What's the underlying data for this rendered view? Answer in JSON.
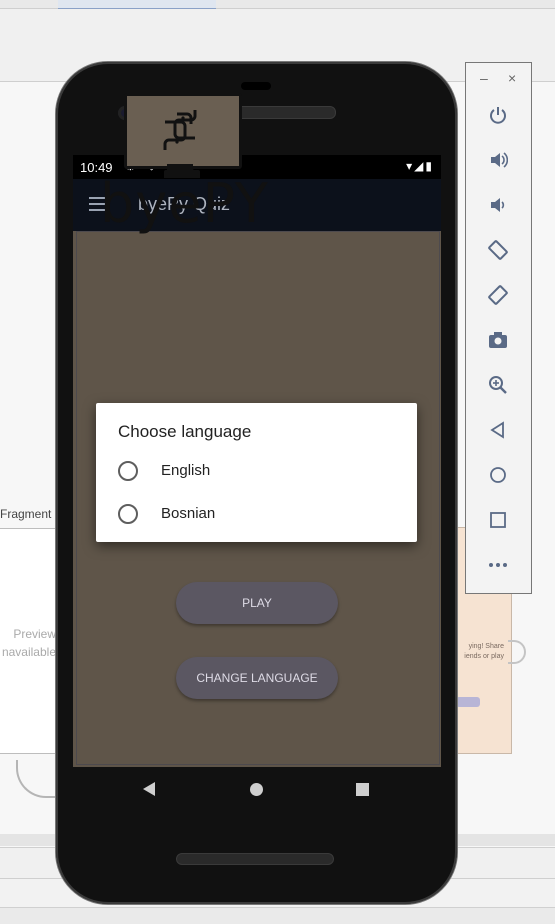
{
  "status_bar": {
    "time": "10:49",
    "left_icons": "⚙ ⛉ ▮ ⊛",
    "right_icons": "▾◢▮"
  },
  "app_bar": {
    "title": "byePy Quiz"
  },
  "logo": {
    "text": "byePY"
  },
  "buttons": {
    "play": "PLAY",
    "change_language": "CHANGE LANGUAGE"
  },
  "dialog": {
    "title": "Choose language",
    "options": [
      {
        "label": "English",
        "selected": false
      },
      {
        "label": "Bosnian",
        "selected": false
      }
    ]
  },
  "ide": {
    "fragment_label": "Fragment",
    "preview_text_1": "Preview",
    "preview_text_2": "navailable",
    "peek_text_1": "ying! Share",
    "peek_text_2": "iends or play"
  },
  "toolbar": {
    "minimize": "–",
    "close": "×",
    "items": [
      {
        "name": "power",
        "glyph": "⏻"
      },
      {
        "name": "volume-up",
        "glyph": "🔊"
      },
      {
        "name": "volume-down",
        "glyph": "🔉"
      },
      {
        "name": "rotate-left",
        "glyph": "⟲"
      },
      {
        "name": "rotate-right",
        "glyph": "⟳"
      },
      {
        "name": "screenshot",
        "glyph": "📷"
      },
      {
        "name": "zoom",
        "glyph": "🔍"
      },
      {
        "name": "back",
        "glyph": "◁"
      },
      {
        "name": "home",
        "glyph": "○"
      },
      {
        "name": "overview",
        "glyph": "□"
      },
      {
        "name": "more",
        "glyph": "•••"
      }
    ]
  },
  "colors": {
    "content_bg": "#5f5549",
    "app_bar_bg": "#0c111b",
    "button_bg": "#5b5762"
  }
}
